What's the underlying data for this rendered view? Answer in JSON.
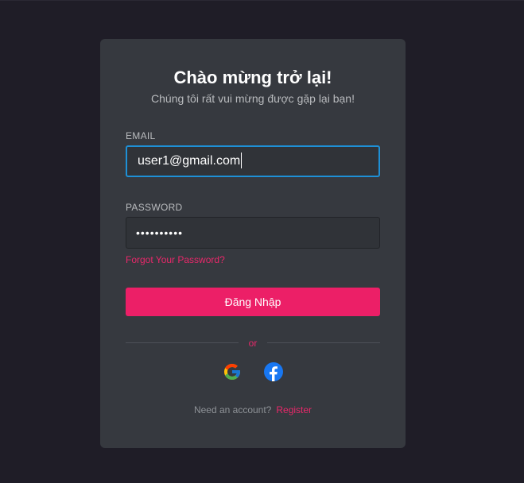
{
  "header": {
    "title": "Chào mừng trở lại!",
    "subtitle": "Chúng tôi rất vui mừng được gặp lại bạn!"
  },
  "form": {
    "email_label": "EMAIL",
    "email_value": "user1@gmail.com",
    "password_label": "PASSWORD",
    "password_value": "••••••••••",
    "forgot_label": "Forgot Your Password?",
    "submit_label": "Đăng Nhập"
  },
  "divider": {
    "label": "or"
  },
  "social": {
    "icons": [
      "google-icon",
      "facebook-icon"
    ]
  },
  "footer": {
    "prompt": "Need an account?",
    "register_label": "Register"
  },
  "colors": {
    "background": "#1f1d27",
    "card": "#36393f",
    "accent": "#ec1f67",
    "focus_border": "#1e90d6"
  }
}
